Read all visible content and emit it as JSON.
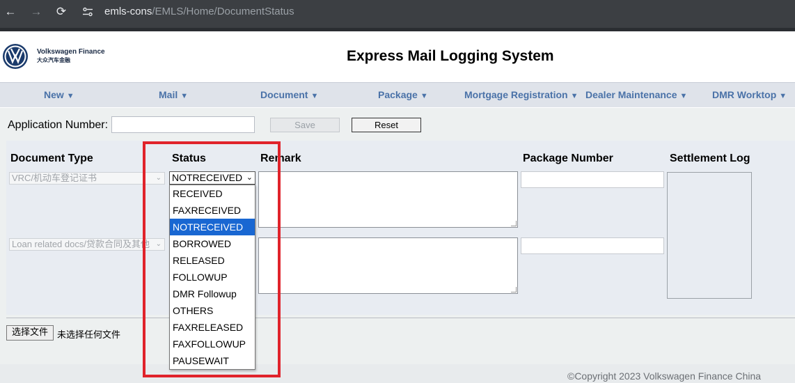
{
  "browser": {
    "url_host": "emls-cons",
    "url_path": "/EMLS/Home/DocumentStatus",
    "back_icon": "←",
    "forward_icon": "→",
    "reload_icon": "⟳"
  },
  "header": {
    "logo_name": "Volkswagen Finance",
    "logo_subtitle": "大众汽车金融",
    "title": "Express Mail Logging System"
  },
  "menu": {
    "items": [
      {
        "label": "New",
        "caret": "▼"
      },
      {
        "label": "Mail",
        "caret": "▼"
      },
      {
        "label": "Document",
        "caret": "▼"
      },
      {
        "label": "Package",
        "caret": "▼"
      },
      {
        "label": "Mortgage Registration",
        "caret": "▼"
      },
      {
        "label": "Dealer Maintenance",
        "caret": "▼"
      },
      {
        "label": "DMR Worktop",
        "caret": "▼"
      }
    ]
  },
  "form": {
    "application_label": "Application Number:",
    "application_value": "",
    "save_label": "Save",
    "reset_label": "Reset"
  },
  "table": {
    "headers": {
      "document_type": "Document Type",
      "status": "Status",
      "remark": "Remark",
      "package_number": "Package Number",
      "settlement_log": "Settlement Log"
    },
    "rows": [
      {
        "document_type": "VRC/机动车登记证书",
        "status": "NOTRECEIVED",
        "remark": "",
        "package_number": ""
      },
      {
        "document_type": "Loan related docs/贷款合同及其他",
        "status": "",
        "remark": "",
        "package_number": ""
      }
    ],
    "select_arrow": "⌄"
  },
  "status_dropdown": {
    "options": [
      "RECEIVED",
      "FAXRECEIVED",
      "NOTRECEIVED",
      "BORROWED",
      "RELEASED",
      "FOLLOWUP",
      "DMR Followup",
      "OTHERS",
      "FAXRELEASED",
      "FAXFOLLOWUP",
      "PAUSEWAIT"
    ],
    "selected": "NOTRECEIVED"
  },
  "file_upload": {
    "button_label": "选择文件",
    "status_text": "未选择任何文件"
  },
  "footer": {
    "copyright": "©Copyright 2023 Volkswagen Finance China"
  },
  "colors": {
    "highlight": "#e0232b",
    "menu_text": "#4a72a8",
    "selected_option": "#1967d2"
  }
}
